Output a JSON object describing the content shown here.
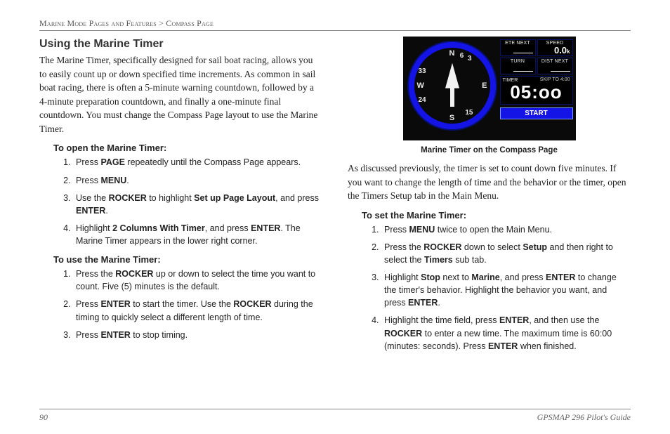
{
  "breadcrumb": {
    "left": "Marine Mode Pages and Features",
    "sep": " > ",
    "right": "Compass Page"
  },
  "title": "Using the Marine Timer",
  "intro": "The Marine Timer, specifically designed for sail boat racing, allows you to easily count up or down specified time increments. As common in sail boat racing, there is often a 5-minute warning countdown, followed by a 4-minute preparation countdown, and finally a one-minute final countdown. You must change the Compass Page layout to use the Marine Timer.",
  "open": {
    "heading": "To open the Marine Timer:",
    "s1a": "Press ",
    "s1b": "PAGE",
    "s1c": " repeatedly until the Compass Page appears.",
    "s2a": "Press ",
    "s2b": "MENU",
    "s2c": ".",
    "s3a": "Use the ",
    "s3b": "ROCKER",
    "s3c": " to highlight ",
    "s3d": "Set up Page Layout",
    "s3e": ", and press ",
    "s3f": "ENTER",
    "s3g": ".",
    "s4a": "Highlight ",
    "s4b": "2 Columns With Timer",
    "s4c": ", and press ",
    "s4d": "ENTER",
    "s4e": ". The Marine Timer appears in the lower right corner."
  },
  "use": {
    "heading": "To use the Marine Timer:",
    "s1a": "Press the ",
    "s1b": "ROCKER",
    "s1c": " up or down to select the time you want to count. Five (5) minutes is the default.",
    "s2a": "Press ",
    "s2b": "ENTER",
    "s2c": " to start the timer. Use the ",
    "s2d": "ROCKER",
    "s2e": " during the timing to quickly select a different length of time.",
    "s3a": "Press ",
    "s3b": "ENTER",
    "s3c": " to stop timing."
  },
  "figure": {
    "caption": "Marine Timer on the Compass Page",
    "ete_label": "ETE NEXT",
    "ete_val": "",
    "speed_label": "SPEED",
    "speed_val": "0.0",
    "speed_unit": "k",
    "turn_label": "TURN",
    "turn_val": "",
    "dist_label": "DIST NEXT",
    "dist_val": "",
    "timer_label": "TIMER",
    "skip": "SKIP TO 4:00",
    "timer_val": "05:oo",
    "start": "START",
    "n": "N",
    "s": "S",
    "e": "E",
    "w": "W",
    "d3": "3",
    "d6": "6",
    "d33": "33",
    "d24": "24",
    "d15": "15"
  },
  "discuss": "As discussed previously, the timer is set to count down five minutes. If you want to change the length of time and the behavior or the timer, open the Timers Setup tab in the Main Menu.",
  "set": {
    "heading": "To set the Marine Timer:",
    "s1a": "Press ",
    "s1b": "MENU",
    "s1c": " twice to open the Main Menu.",
    "s2a": "Press the ",
    "s2b": "ROCKER",
    "s2c": " down to select ",
    "s2d": "Setup",
    "s2e": " and then right to select the ",
    "s2f": "Timers",
    "s2g": " sub tab.",
    "s3a": "Highlight ",
    "s3b": "Stop",
    "s3c": " next to ",
    "s3d": "Marine",
    "s3e": ", and press ",
    "s3f": "ENTER",
    "s3g": " to change the timer's behavior. Highlight the behavior you want, and press ",
    "s3h": "ENTER",
    "s3i": ".",
    "s4a": "Highlight the time field, press ",
    "s4b": "ENTER",
    "s4c": ", and then use the ",
    "s4d": "ROCKER",
    "s4e": " to enter a new time. The maximum time is 60:00 (minutes: seconds). Press ",
    "s4f": "ENTER",
    "s4g": " when finished."
  },
  "footer": {
    "page": "90",
    "guide": "GPSMAP 296 Pilot's Guide"
  }
}
